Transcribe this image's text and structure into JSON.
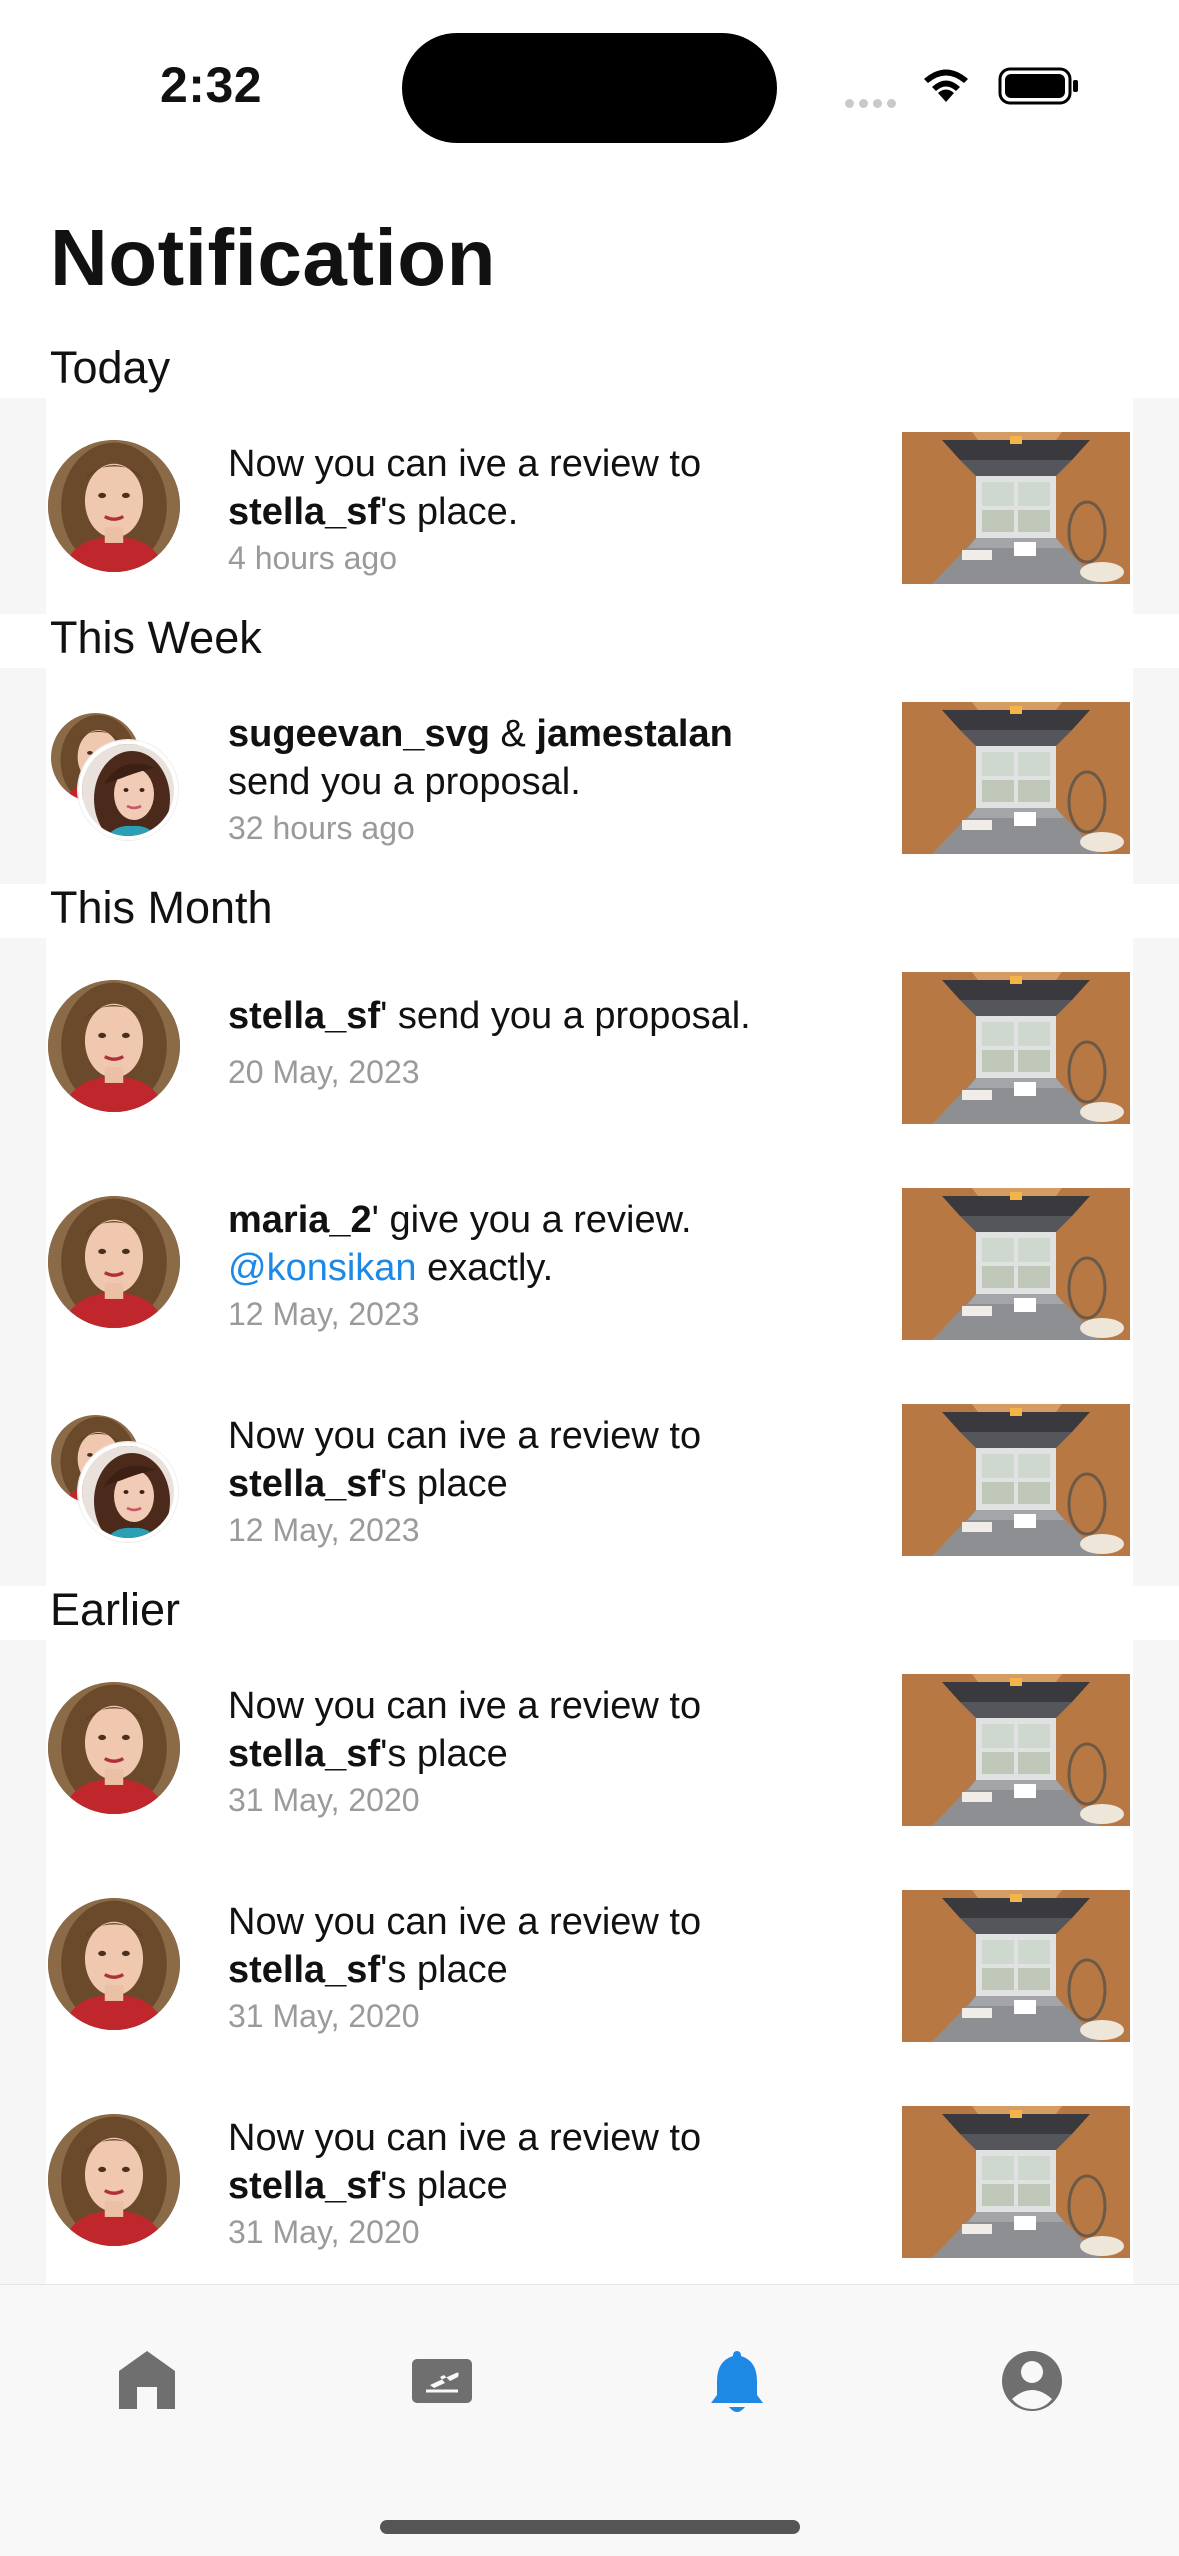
{
  "status_bar": {
    "time": "2:32"
  },
  "page_title": "Notification",
  "sections": [
    {
      "title": "Today",
      "items": [
        {
          "avatar": "single",
          "line1_pre": "Now you can ive a review to ",
          "line1_bold": "",
          "line2_bold": "stella_sf",
          "line2_rest": "'s place.",
          "mention": "",
          "mention_rest": "",
          "time": "4 hours ago"
        }
      ]
    },
    {
      "title": "This Week",
      "items": [
        {
          "avatar": "pair",
          "bold1": "sugeevan_svg",
          "amp": " & ",
          "bold2": "jamestalan",
          "rest": "send you a proposal.",
          "time": "32 hours ago"
        }
      ]
    },
    {
      "title": "This Month",
      "items": [
        {
          "avatar": "single",
          "bold": "stella_sf",
          "rest": "' send you a proposal.",
          "time": "20 May, 2023"
        },
        {
          "avatar": "single",
          "bold": "maria_2",
          "rest": "' give you a review.",
          "mention": "@konsikan",
          "mention_rest": " exactly.",
          "time": "12 May, 2023"
        },
        {
          "avatar": "pair",
          "line1": "Now you can ive a review to",
          "bold": "stella_sf",
          "rest": "'s place",
          "time": "12 May, 2023"
        }
      ]
    },
    {
      "title": "Earlier",
      "items": [
        {
          "avatar": "single",
          "line1": "Now you can ive a review to",
          "bold": "stella_sf",
          "rest": "'s place",
          "time": "31 May, 2020"
        },
        {
          "avatar": "single",
          "line1": "Now you can ive a review to",
          "bold": "stella_sf",
          "rest": "'s place",
          "time": "31 May, 2020"
        },
        {
          "avatar": "single",
          "line1": "Now you can ive a review to",
          "bold": "stella_sf",
          "rest": "'s place",
          "time": "31 May, 2020"
        }
      ]
    }
  ],
  "tab_bar": {
    "active_color": "#1e88e5",
    "inactive_color": "#6f6f6f",
    "tabs": [
      {
        "icon": "home-icon",
        "active": false
      },
      {
        "icon": "ticket-icon",
        "active": false
      },
      {
        "icon": "bell-icon",
        "active": true
      },
      {
        "icon": "account-icon",
        "active": false
      }
    ]
  }
}
